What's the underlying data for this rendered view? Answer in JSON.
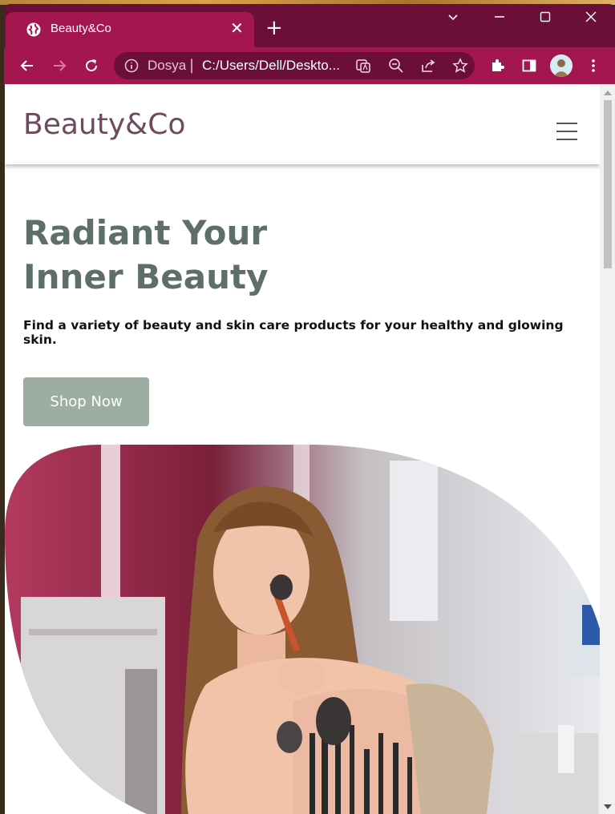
{
  "browser": {
    "tab_title": "Beauty&Co",
    "tab_close": "✕",
    "new_tab": "+",
    "omnibox": {
      "scheme_label": "Dosya",
      "separator": "|",
      "url": "C:/Users/Dell/Deskto..."
    },
    "colors": {
      "frame": "#6b0f39",
      "toolbar": "#a3164f"
    },
    "icons": [
      "back-icon",
      "forward-icon",
      "reload-icon",
      "info-icon",
      "translate-icon",
      "zoom-icon",
      "share-icon",
      "bookmark-star-icon",
      "extensions-icon",
      "side-panel-icon",
      "profile-avatar",
      "menu-dots-icon",
      "tab-search-icon",
      "minimize-icon",
      "maximize-icon",
      "close-window-icon"
    ]
  },
  "site": {
    "logo": "Beauty&Co",
    "hero": {
      "title_line1": "Radiant Your",
      "title_line2": "Inner Beauty",
      "subtitle": "Find a variety of beauty and skin care products for your healthy and glowing skin.",
      "cta": "Shop Now"
    },
    "colors": {
      "logo": "#6e4a5e",
      "title": "#5e6f68",
      "button": "#9baea1"
    }
  }
}
